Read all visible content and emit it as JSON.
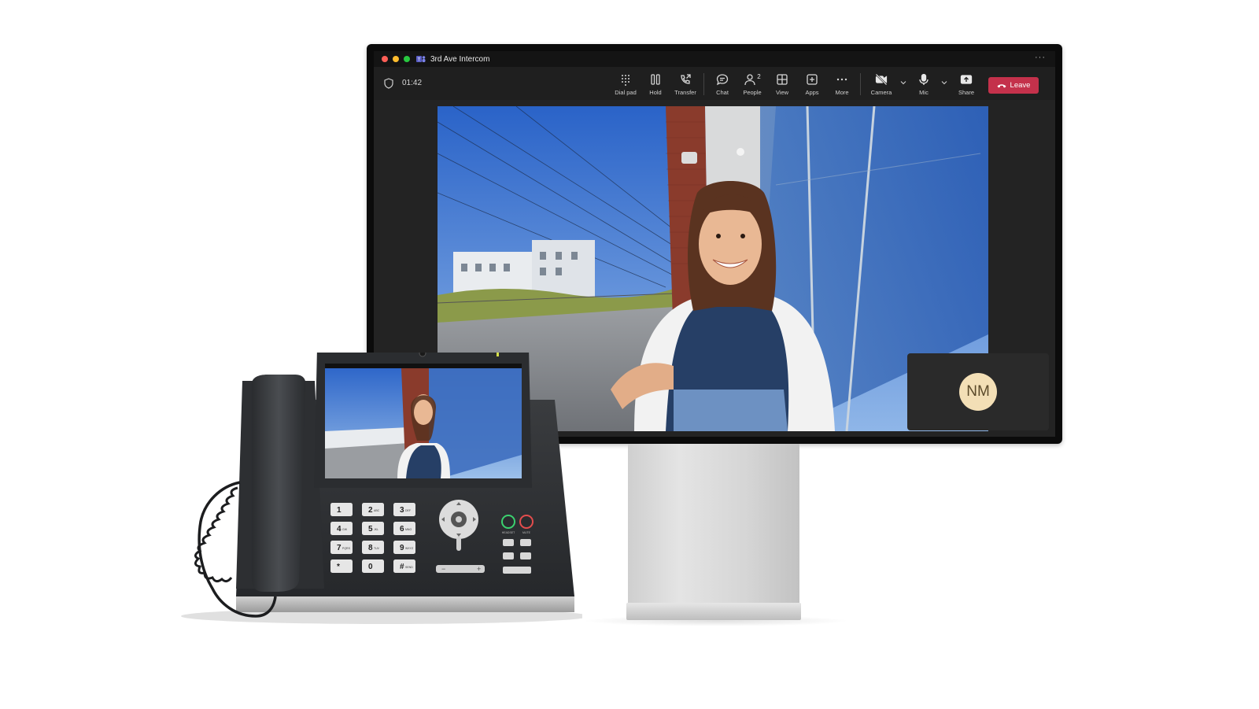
{
  "window": {
    "title": "3rd Ave Intercom",
    "more_icon": "ellipsis-icon"
  },
  "call": {
    "timer": "01:42"
  },
  "toolbar": {
    "dial_pad": "Dial pad",
    "hold": "Hold",
    "transfer": "Transfer",
    "chat": "Chat",
    "people": "People",
    "people_count": "2",
    "view": "View",
    "apps": "Apps",
    "more": "More",
    "camera": "Camera",
    "mic": "Mic",
    "share": "Share",
    "leave": "Leave"
  },
  "self_view": {
    "initials": "NM"
  },
  "colors": {
    "leave": "#c4314b",
    "avatar_bg": "#f3dfb6",
    "traffic_red": "#ff5f57",
    "traffic_yellow": "#febc2e",
    "traffic_green": "#28c840"
  },
  "desk_phone": {
    "keys": [
      {
        "digit": "1",
        "letters": ""
      },
      {
        "digit": "2",
        "letters": "ABC"
      },
      {
        "digit": "3",
        "letters": "DEF"
      },
      {
        "digit": "4",
        "letters": "GHI"
      },
      {
        "digit": "5",
        "letters": "JKL"
      },
      {
        "digit": "6",
        "letters": "MNO"
      },
      {
        "digit": "7",
        "letters": "PQRS"
      },
      {
        "digit": "8",
        "letters": "TUV"
      },
      {
        "digit": "9",
        "letters": "WXYZ"
      },
      {
        "digit": "*",
        "letters": ""
      },
      {
        "digit": "0",
        "letters": ""
      },
      {
        "digit": "#",
        "letters": "SEND"
      }
    ],
    "headset_label": "HEADSET",
    "mute_label": "MUTE"
  }
}
